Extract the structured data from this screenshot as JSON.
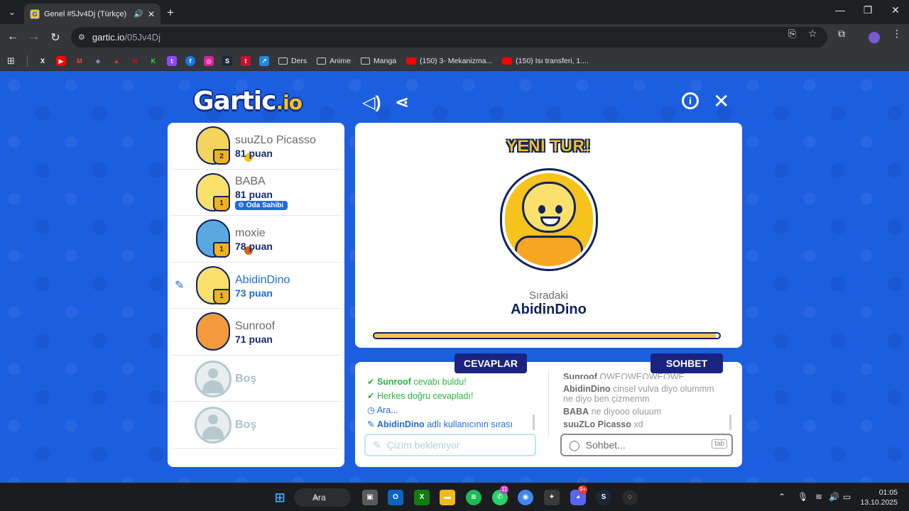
{
  "browser": {
    "tab_title": "Genel #5Jv4Dj (Türkçe) - Ga",
    "url_domain": "gartic.io",
    "url_path": "/05Jv4Dj",
    "bookmarks": [
      {
        "label": "Ders",
        "kind": "folder"
      },
      {
        "label": "Anime",
        "kind": "folder"
      },
      {
        "label": "Manga",
        "kind": "folder"
      },
      {
        "label": "(150) 3- Mekanizma...",
        "kind": "youtube"
      },
      {
        "label": "(150) Isı transferi, 1....",
        "kind": "youtube"
      }
    ]
  },
  "game": {
    "logo": "Gartic",
    "logo_suffix": ".io",
    "players": [
      {
        "name": "suuZLo Picasso",
        "score": "81 puan",
        "rank": "2",
        "badge_color": "#f6c21c"
      },
      {
        "name": "BABA",
        "score": "81 puan",
        "rank": "1",
        "badge_color": "#c8c8c8",
        "host_label": "Oda Sahibi"
      },
      {
        "name": "moxie",
        "score": "78 puan",
        "rank": "1",
        "badge_color": "#d9661a"
      },
      {
        "name": "AbidinDino",
        "score": "73 puan",
        "rank": "1",
        "drawing": true
      },
      {
        "name": "Sunroof",
        "score": "71 puan"
      },
      {
        "name": "Boş",
        "empty": true
      },
      {
        "name": "Boş",
        "empty": true
      }
    ],
    "board": {
      "round_title": "YENI TUR!",
      "next_label": "Sıradaki",
      "next_player": "AbidinDino",
      "progress": 0.99
    },
    "answers": {
      "tab_label": "CEVAPLAR",
      "lines": [
        {
          "icon": "check",
          "bold": "Sunroof",
          "text": " cevabı buldu!"
        },
        {
          "icon": "check",
          "bold": "",
          "text": "Herkes doğru cevapladı!"
        },
        {
          "icon": "clock",
          "bold": "",
          "text": "Ara..."
        },
        {
          "icon": "pencil",
          "bold": "AbidinDino",
          "text": " adlı kullanıcının sırası"
        }
      ],
      "input_placeholder": "Çizim bekleniyor"
    },
    "chat": {
      "tab_label": "SOHBET",
      "messages": [
        {
          "user": "Sunroof",
          "text": "QWEQWEQWEQWE"
        },
        {
          "user": "AbidinDino",
          "text": "cinsel vulva diyo olummm",
          "text2": "ne diyo ben çizmemm"
        },
        {
          "user": "BABA",
          "text": "ne diyooo oluuum"
        },
        {
          "user": "suuZLo Picasso",
          "text": "xd"
        }
      ],
      "input_placeholder": "Sohbet...",
      "tab_hint": "tab"
    }
  },
  "taskbar": {
    "search_label": "Ara",
    "whatsapp_badge": "11",
    "discord_badge": "9+",
    "time": "01:05",
    "date": "13.10.2025"
  }
}
